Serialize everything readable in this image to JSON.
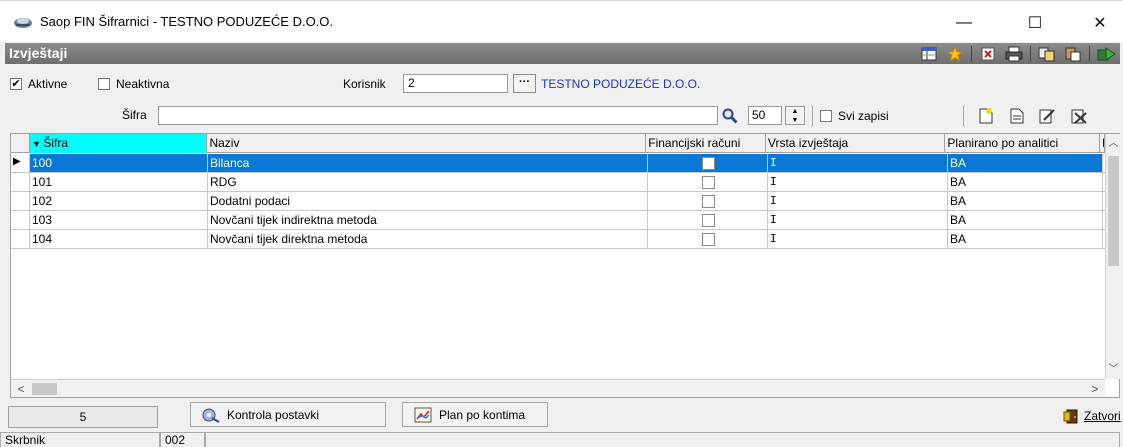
{
  "window": {
    "title": "Saop FIN Šifrarnici - TESTNO PODUZEĆE D.O.O.",
    "minimize": "—",
    "maximize": "☐",
    "close": "✕"
  },
  "header": {
    "title": "Izvještaji",
    "icons": [
      "columns-icon",
      "favorite-star-icon",
      "export-icon",
      "print-icon",
      "copy-icon",
      "paste-icon",
      "exit-icon"
    ]
  },
  "filter": {
    "aktivne_label": "Aktivne",
    "aktivne_checked": true,
    "neaktivna_label": "Neaktivna",
    "neaktivna_checked": false,
    "korisnik_label": "Korisnik",
    "korisnik_value": "2",
    "browse_label": "···",
    "company": "TESTNO PODUZEĆE D.O.O."
  },
  "search": {
    "sifra_label": "Šifra",
    "sifra_value": "",
    "count_value": "50",
    "svi_zapisi_label": "Svi zapisi",
    "svi_zapisi_checked": false
  },
  "grid": {
    "columns": [
      "Šifra",
      "Naziv",
      "Financijski računi",
      "Vrsta izvještaja",
      "Planirano po analitici",
      "I"
    ],
    "rows": [
      {
        "sifra": "100",
        "naziv": "Bilanca",
        "fin": false,
        "vrsta": "I",
        "plan": "BA"
      },
      {
        "sifra": "101",
        "naziv": "RDG",
        "fin": false,
        "vrsta": "I",
        "plan": "BA"
      },
      {
        "sifra": "102",
        "naziv": "Dodatni podaci",
        "fin": false,
        "vrsta": "I",
        "plan": "BA"
      },
      {
        "sifra": "103",
        "naziv": "Novčani tijek indirektna metoda",
        "fin": false,
        "vrsta": "I",
        "plan": "BA"
      },
      {
        "sifra": "104",
        "naziv": "Novčani tijek direktna metoda",
        "fin": false,
        "vrsta": "I",
        "plan": "BA"
      }
    ],
    "selected_row": 0
  },
  "footer": {
    "record_count": "5",
    "kontrola_label": "Kontrola postavki",
    "plan_label": "Plan po kontima",
    "zatvori_label": "Zatvori"
  },
  "status": {
    "user": "Skrbnik",
    "code": "002"
  },
  "colors": {
    "header_bg": "#7d7d7d",
    "selection": "#0a78d7",
    "sort_column": "#00ffff",
    "link": "#1a35c8"
  }
}
